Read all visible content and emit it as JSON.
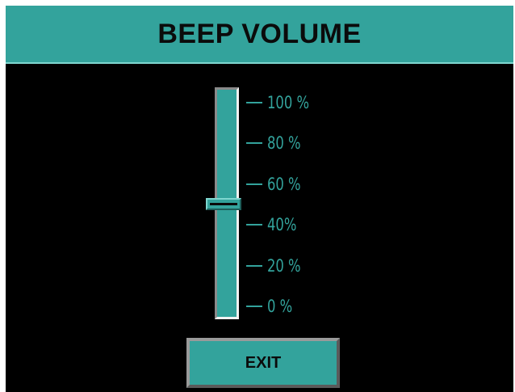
{
  "header": {
    "title": "BEEP VOLUME"
  },
  "volume_slider": {
    "current_percent": 50,
    "scale": [
      {
        "label": "100 %",
        "value": 100
      },
      {
        "label": "80 %",
        "value": 80
      },
      {
        "label": "60 %",
        "value": 60
      },
      {
        "label": "40%",
        "value": 40
      },
      {
        "label": "20 %",
        "value": 20
      },
      {
        "label": "0 %",
        "value": 0
      }
    ]
  },
  "footer": {
    "exit_label": "EXIT"
  },
  "colors": {
    "accent": "#33a39c",
    "background": "#000000",
    "text_dark": "#0b0b0b"
  }
}
